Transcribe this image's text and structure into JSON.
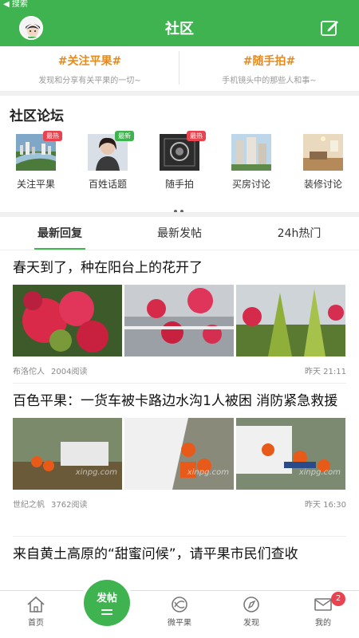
{
  "status": {
    "back_label": "◀ 搜索"
  },
  "header": {
    "title": "社区"
  },
  "topics": [
    {
      "title": "#关注平果#",
      "desc": "发现和分享有关平果的一切~"
    },
    {
      "title": "#随手拍#",
      "desc": "手机镜头中的那些人和事~"
    }
  ],
  "forum": {
    "title": "社区论坛",
    "items": [
      {
        "label": "关注平果",
        "badge": "最热",
        "badge_color": "#e8434e",
        "thumb": "city-thumb"
      },
      {
        "label": "百姓话题",
        "badge": "最新",
        "badge_color": "#3fb34f",
        "thumb": "person-thumb"
      },
      {
        "label": "随手拍",
        "badge": "最热",
        "badge_color": "#e8434e",
        "thumb": "photo-thumb"
      },
      {
        "label": "买房讨论",
        "badge": "",
        "badge_color": "",
        "thumb": "buildings-thumb"
      },
      {
        "label": "装修讨论",
        "badge": "",
        "badge_color": "",
        "thumb": "interior-thumb"
      }
    ]
  },
  "tabs": [
    {
      "label": "最新回复",
      "active": true
    },
    {
      "label": "最新发帖",
      "active": false
    },
    {
      "label": "24h热门",
      "active": false
    }
  ],
  "posts": [
    {
      "title": "春天到了，种在阳台上的花开了",
      "author": "布洛佗人",
      "views": "2004阅读",
      "time": "昨天 21:11"
    },
    {
      "title": "百色平果：一货车被卡路边水沟1人被困 消防紧急救援",
      "author": "世纪之帆",
      "views": "3762阅读",
      "time": "昨天 16:30",
      "watermark": "xinpg.com"
    },
    {
      "title": "来自黄土高原的“甜蜜问候”，请平果市民们查收"
    }
  ],
  "bottom_nav": {
    "items": [
      {
        "label": "首页",
        "icon": "home-icon"
      },
      {
        "label": "",
        "icon": "spacer"
      },
      {
        "label": "微平果",
        "icon": "weipingguo-icon"
      },
      {
        "label": "发现",
        "icon": "compass-icon"
      },
      {
        "label": "我的",
        "icon": "mail-icon"
      }
    ],
    "post_button": "发帖",
    "badge_count": "2"
  },
  "colors": {
    "brand": "#3fb34f",
    "topic": "#e88a1a",
    "badge_red": "#e8434e"
  }
}
